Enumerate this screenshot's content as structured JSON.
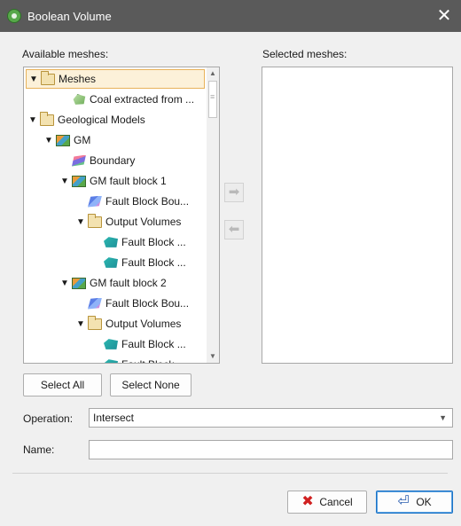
{
  "window": {
    "title": "Boolean Volume",
    "close_glyph": "✕"
  },
  "available_label": "Available meshes:",
  "selected_label": "Selected meshes:",
  "tree": [
    {
      "label": "Meshes",
      "icon": "folder-icon",
      "expand": "▼",
      "selected": true
    },
    {
      "label": "Coal extracted from ...",
      "icon": "mesh-icon",
      "expand": ""
    },
    {
      "label": "Geological Models",
      "icon": "folder-icon",
      "expand": "▼"
    },
    {
      "label": "GM",
      "icon": "model-icon",
      "expand": "▼"
    },
    {
      "label": "Boundary",
      "icon": "boundary-icon",
      "expand": ""
    },
    {
      "label": "GM fault block 1",
      "icon": "model-icon",
      "expand": "▼"
    },
    {
      "label": "Fault Block Bou...",
      "icon": "fault-bb-icon",
      "expand": ""
    },
    {
      "label": "Output Volumes",
      "icon": "folder-icon",
      "expand": "▼"
    },
    {
      "label": "Fault Block ...",
      "icon": "fault-vol-icon",
      "expand": ""
    },
    {
      "label": "Fault Block ...",
      "icon": "fault-vol-icon",
      "expand": ""
    },
    {
      "label": "GM fault block 2",
      "icon": "model-icon",
      "expand": "▼"
    },
    {
      "label": "Fault Block Bou...",
      "icon": "fault-bb-icon",
      "expand": ""
    },
    {
      "label": "Output Volumes",
      "icon": "folder-icon",
      "expand": "▼"
    },
    {
      "label": "Fault Block ...",
      "icon": "fault-vol-icon",
      "expand": ""
    },
    {
      "label": "Fault Block ...",
      "icon": "fault-vol-icon",
      "expand": ""
    }
  ],
  "buttons": {
    "move_right": "➡",
    "move_left": "⬅",
    "select_all": "Select All",
    "select_none": "Select None",
    "cancel": "Cancel",
    "ok": "OK"
  },
  "operation": {
    "label": "Operation:",
    "value": "Intersect",
    "arrow": "▼"
  },
  "name": {
    "label": "Name:",
    "value": ""
  }
}
